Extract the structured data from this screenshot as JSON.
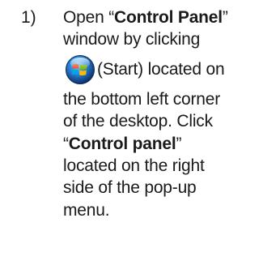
{
  "step": {
    "number": "1)",
    "lines": {
      "l1_prefix": "Open “",
      "l1_bold": "Control Panel",
      "l1_suffix": "”",
      "l2": "window by clicking",
      "l3_after_icon": " (Start) located on",
      "l4": "the bottom left corner",
      "l5": "of the desktop. Click",
      "l6_prefix": "“",
      "l6_bold": "Control panel",
      "l6_suffix": "”",
      "l7": "located on the right",
      "l8": "side of the pop-up",
      "l9": "menu."
    },
    "icon": "windows-start-orb-icon"
  }
}
